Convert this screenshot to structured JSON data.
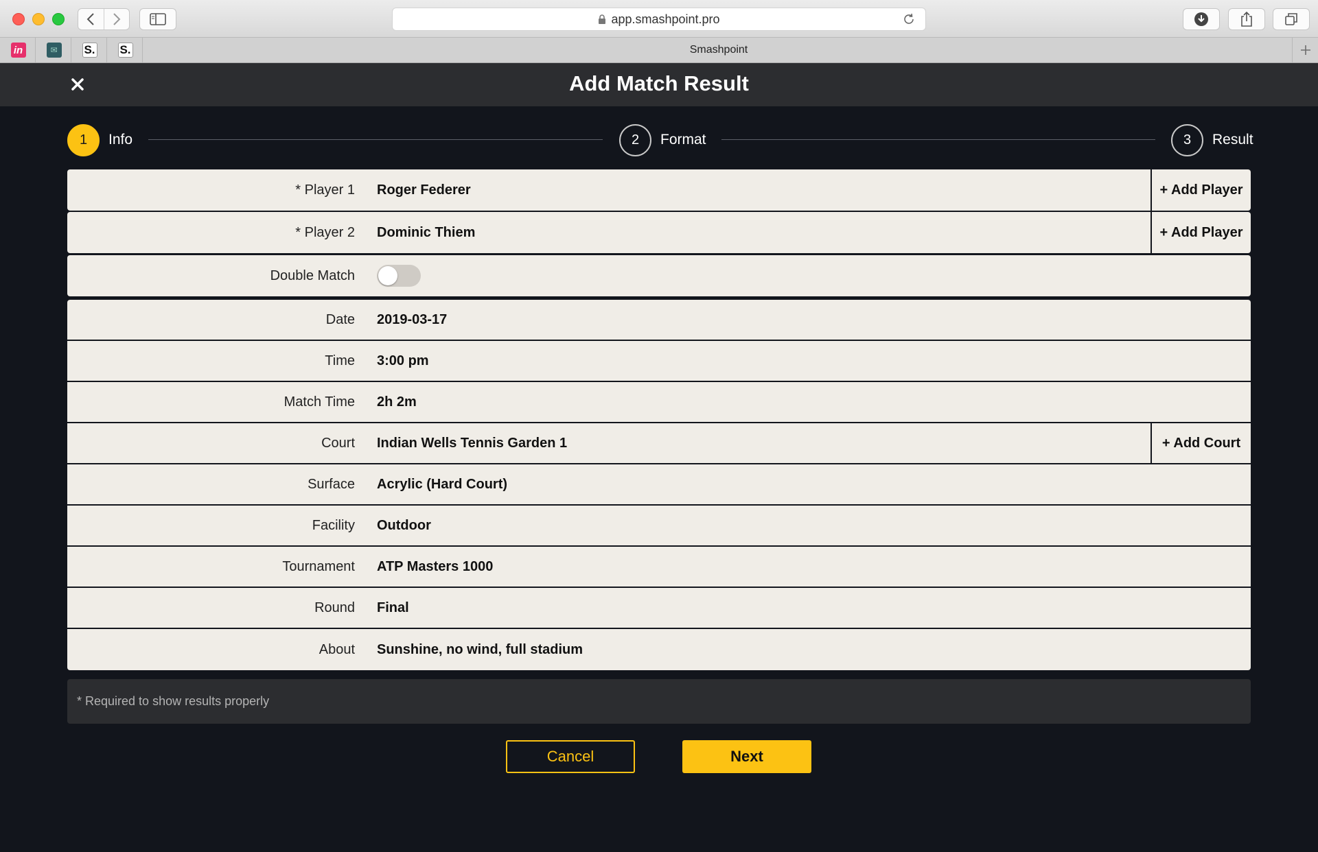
{
  "browser": {
    "url": "app.smashpoint.pro",
    "tab_title": "Smashpoint",
    "favorites": [
      {
        "name": "invision",
        "glyph": "in"
      },
      {
        "name": "mail",
        "glyph": "✉"
      },
      {
        "name": "smashpoint-1",
        "glyph": "S."
      },
      {
        "name": "smashpoint-2",
        "glyph": "S."
      }
    ]
  },
  "header": {
    "title": "Add Match Result",
    "close_icon": "✕"
  },
  "stepper": {
    "steps": [
      {
        "number": "1",
        "label": "Info",
        "active": true
      },
      {
        "number": "2",
        "label": "Format",
        "active": false
      },
      {
        "number": "3",
        "label": "Result",
        "active": false
      }
    ]
  },
  "form": {
    "player1": {
      "label": "* Player 1",
      "value": "Roger Federer",
      "action": "+ Add Player"
    },
    "player2": {
      "label": "* Player 2",
      "value": "Dominic Thiem",
      "action": "+ Add Player"
    },
    "double_match": {
      "label": "Double Match",
      "on": false
    },
    "date": {
      "label": "Date",
      "value": "2019-03-17"
    },
    "time": {
      "label": "Time",
      "value": "3:00 pm"
    },
    "match_time": {
      "label": "Match Time",
      "value": "2h 2m"
    },
    "court": {
      "label": "Court",
      "value": "Indian Wells Tennis Garden 1",
      "action": "+ Add Court"
    },
    "surface": {
      "label": "Surface",
      "value": "Acrylic (Hard Court)"
    },
    "facility": {
      "label": "Facility",
      "value": "Outdoor"
    },
    "tournament": {
      "label": "Tournament",
      "value": "ATP Masters 1000"
    },
    "round": {
      "label": "Round",
      "value": "Final"
    },
    "about": {
      "label": "About",
      "value": "Sunshine, no wind, full stadium"
    }
  },
  "note": "* Required to show results properly",
  "buttons": {
    "cancel": "Cancel",
    "next": "Next"
  },
  "colors": {
    "accent": "#fcc213",
    "background": "#12151c",
    "header": "#2c2d30",
    "row": "#f0ede7"
  }
}
